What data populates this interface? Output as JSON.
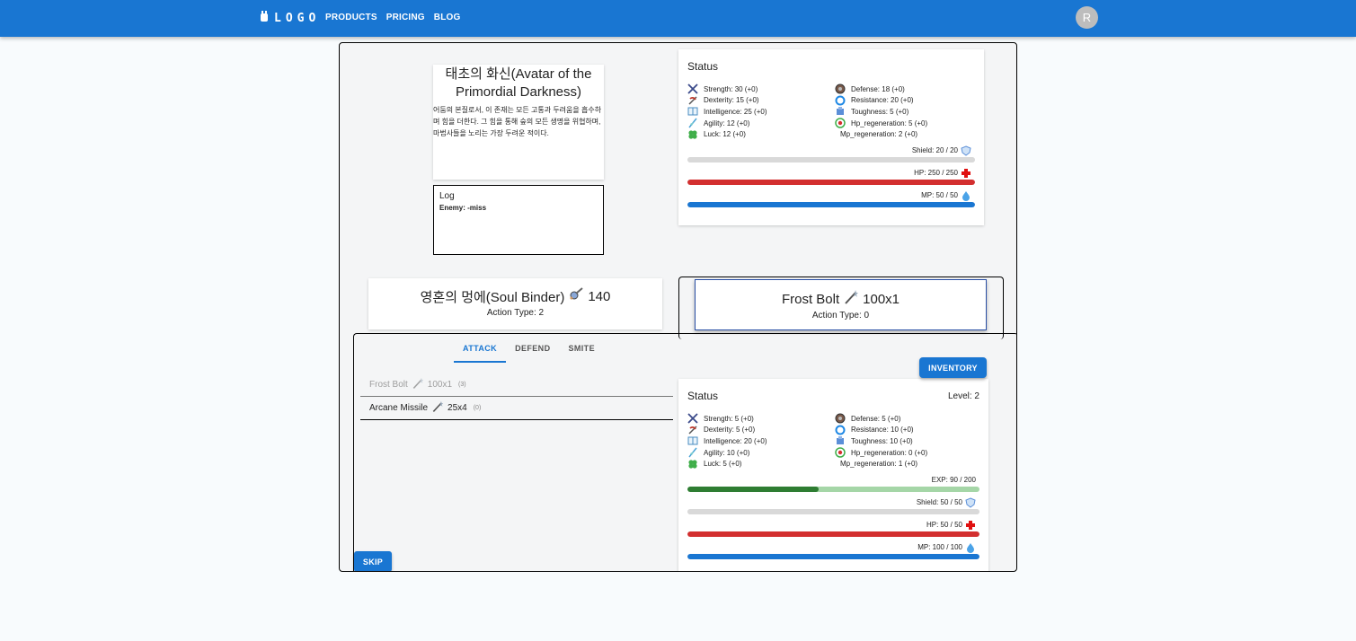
{
  "nav": {
    "logo": "LOGO",
    "links": [
      "PRODUCTS",
      "PRICING",
      "BLOG"
    ],
    "avatar_initial": "R"
  },
  "enemy": {
    "name": "태초의 화신(Avatar of the Primordial Darkness)",
    "description": "어둠의 본질로서, 이 존재는 모든 고통과 두려움을 흡수하며 힘을 더한다. 그 힘을 통해 숲의 모든 생명을 위협하며, 마법사들을 노리는 가장 두려운 적이다.",
    "log_title": "Log",
    "log_lines": [
      "Enemy: -miss"
    ],
    "status": {
      "title": "Status",
      "stats_left": [
        {
          "icon": "sword-icon",
          "text": "Strength: 30 (+0)"
        },
        {
          "icon": "dexterity-icon",
          "text": "Dexterity: 15 (+0)"
        },
        {
          "icon": "book-icon",
          "text": "Intelligence: 25 (+0)"
        },
        {
          "icon": "agility-icon",
          "text": "Agility: 12 (+0)"
        },
        {
          "icon": "clover-icon",
          "text": "Luck: 12 (+0)"
        }
      ],
      "stats_right": [
        {
          "icon": "defense-icon",
          "text": "Defense: 18 (+0)"
        },
        {
          "icon": "resistance-icon",
          "text": "Resistance: 20 (+0)"
        },
        {
          "icon": "toughness-icon",
          "text": "Toughness: 5 (+0)"
        },
        {
          "icon": "hp-regen-icon",
          "text": "Hp_regeneration: 5 (+0)"
        },
        {
          "icon": "",
          "text": "Mp_regeneration: 2 (+0)"
        }
      ],
      "bars": [
        {
          "label": "Shield: 20 / 20",
          "icon": "shield-icon",
          "fraction": 1.0,
          "color": "#d9d9d9"
        },
        {
          "label": "HP: 250 / 250",
          "icon": "hp-cross-icon",
          "fraction": 1.0,
          "color": "#d32f2f"
        },
        {
          "label": "MP: 50 / 50",
          "icon": "mp-drop-icon",
          "fraction": 1.0,
          "color": "#1976d2"
        }
      ]
    }
  },
  "enemy_action": {
    "name": "영혼의 멍에(Soul Binder)",
    "value": "140",
    "action_type": "Action Type: 2"
  },
  "player_action": {
    "name": "Frost Bolt",
    "value": "100x1",
    "action_type": "Action Type: 0"
  },
  "tabs": [
    "ATTACK",
    "DEFEND",
    "SMITE"
  ],
  "skills": [
    {
      "name": "Frost Bolt",
      "value": "100x1",
      "uses": "(3)",
      "disabled": true
    },
    {
      "name": "Arcane Missile",
      "value": "25x4",
      "uses": "(0)",
      "disabled": false
    }
  ],
  "buttons": {
    "inventory": "INVENTORY",
    "skip": "SKIP"
  },
  "player": {
    "status": {
      "title": "Status",
      "level": "Level: 2",
      "stats_left": [
        {
          "icon": "sword-icon",
          "text": "Strength: 5 (+0)"
        },
        {
          "icon": "dexterity-icon",
          "text": "Dexterity: 5 (+0)"
        },
        {
          "icon": "book-icon",
          "text": "Intelligence: 20 (+0)"
        },
        {
          "icon": "agility-icon",
          "text": "Agility: 10 (+0)"
        },
        {
          "icon": "clover-icon",
          "text": "Luck: 5 (+0)"
        }
      ],
      "stats_right": [
        {
          "icon": "defense-icon",
          "text": "Defense: 5 (+0)"
        },
        {
          "icon": "resistance-icon",
          "text": "Resistance: 10 (+0)"
        },
        {
          "icon": "toughness-icon",
          "text": "Toughness: 10 (+0)"
        },
        {
          "icon": "hp-regen-icon",
          "text": "Hp_regeneration: 0 (+0)"
        },
        {
          "icon": "",
          "text": "Mp_regeneration: 1 (+0)"
        }
      ],
      "bars": [
        {
          "label": "EXP: 90 / 200",
          "icon": "",
          "fraction": 0.45,
          "color": "#2e7d32",
          "track": "#a5d6a7"
        },
        {
          "label": "Shield: 50 / 50",
          "icon": "shield-icon",
          "fraction": 1.0,
          "color": "#d9d9d9"
        },
        {
          "label": "HP: 50 / 50",
          "icon": "hp-cross-icon",
          "fraction": 1.0,
          "color": "#d32f2f"
        },
        {
          "label": "MP: 100 / 100",
          "icon": "mp-drop-icon",
          "fraction": 1.0,
          "color": "#1976d2"
        }
      ]
    }
  }
}
